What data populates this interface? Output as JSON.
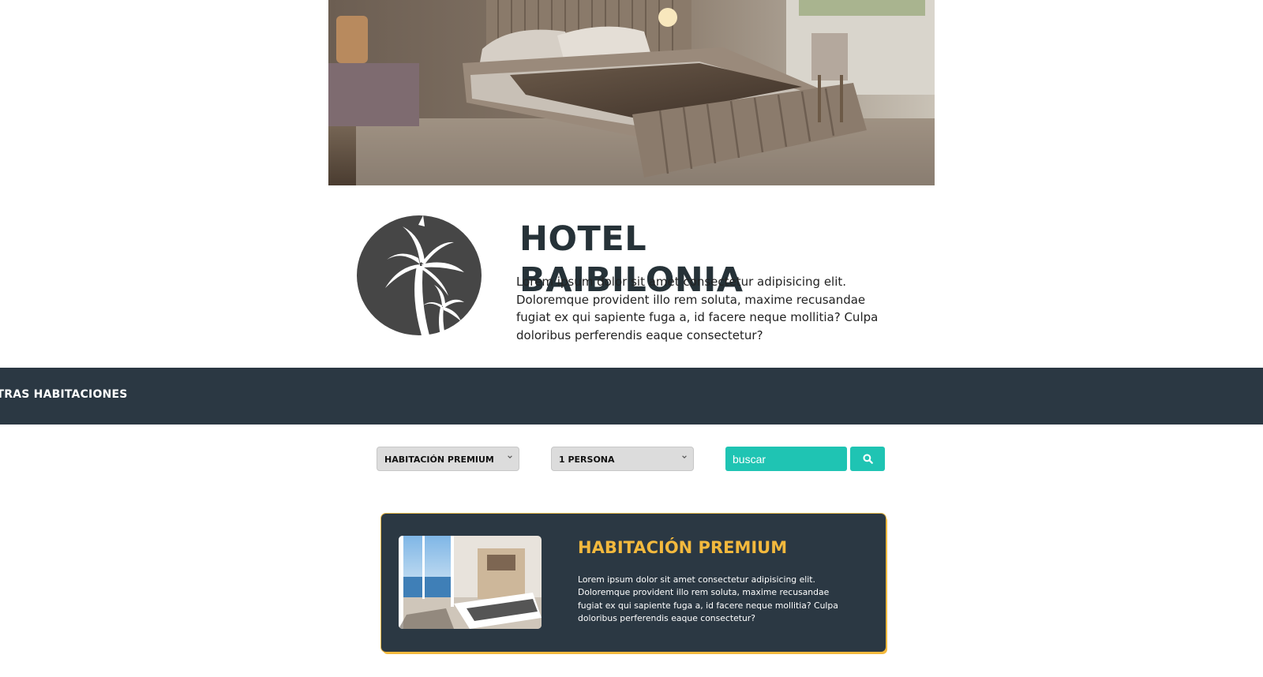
{
  "hotel": {
    "title": "HOTEL BAIBILONIA",
    "description": "Lorem ipsum dolor sit amet consectetur adipisicing elit. Doloremque provident illo rem soluta, maxime recusandae fugiat ex qui sapiente fuga a, id facere neque mollitia? Culpa doloribus perferendis eaque consectetur?",
    "logo_icon": "palm-tree-icon"
  },
  "section": {
    "title": "NUESTRAS HABITACIONES"
  },
  "filters": {
    "room_type": "HABITACIÓN PREMIUM",
    "persons": "1 PERSONA",
    "search_placeholder": "buscar",
    "search_icon": "search-icon"
  },
  "rooms": [
    {
      "title": "HABITACIÓN PREMIUM",
      "description": "Lorem ipsum dolor sit amet consectetur adipisicing elit. Doloremque provident illo rem soluta, maxime recusandae fugiat ex qui sapiente fuga a, id facere neque mollitia? Culpa doloribus perferendis eaque consectetur?"
    }
  ],
  "colors": {
    "dark": "#2b3843",
    "accent": "#1fc4b3",
    "gold": "#f3b93d"
  }
}
